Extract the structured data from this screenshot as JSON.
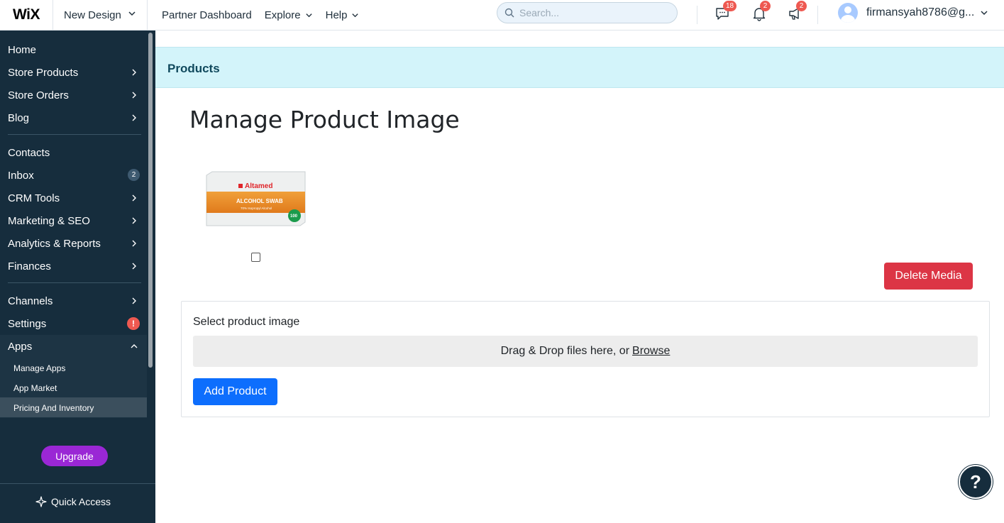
{
  "topbar": {
    "logo": "WiX",
    "site_name": "New Design",
    "nav": [
      "Partner Dashboard",
      "Explore",
      "Help"
    ],
    "search_placeholder": "Search...",
    "badges": {
      "messages": "18",
      "notifications": "2",
      "announcements": "2"
    },
    "user_email": "firmansyah8786@g..."
  },
  "sidebar": {
    "items": [
      {
        "label": "Home"
      },
      {
        "label": "Store Products"
      },
      {
        "label": "Store Orders"
      },
      {
        "label": "Blog"
      },
      {
        "label": "Contacts"
      },
      {
        "label": "Inbox",
        "badge": "2"
      },
      {
        "label": "CRM Tools"
      },
      {
        "label": "Marketing & SEO"
      },
      {
        "label": "Analytics & Reports"
      },
      {
        "label": "Finances"
      },
      {
        "label": "Channels"
      },
      {
        "label": "Settings",
        "alert": "!"
      },
      {
        "label": "Apps"
      }
    ],
    "apps_sub": [
      {
        "label": "Manage Apps"
      },
      {
        "label": "App Market"
      },
      {
        "label": "Pricing And Inventory"
      }
    ],
    "upgrade_label": "Upgrade",
    "quick_access_label": "Quick Access"
  },
  "main": {
    "band_title": "Products",
    "heading": "Manage Product Image",
    "product_image": {
      "brand": "Altamed",
      "product": "ALCOHOL SWAB",
      "sub": "70% Isopropyl Alcohol",
      "count": "100"
    },
    "delete_label": "Delete Media",
    "upload_label": "Select product image",
    "dropzone_text": "Drag & Drop files here, or",
    "browse_label": "Browse",
    "add_label": "Add Product",
    "help_label": "?"
  },
  "colors": {
    "sidebar_bg": "#162d3d",
    "band_bg": "#d3f4fa",
    "delete": "#dc3545",
    "primary": "#0d6efd",
    "upgrade": "#9a27d5",
    "badge": "#ee5951"
  }
}
